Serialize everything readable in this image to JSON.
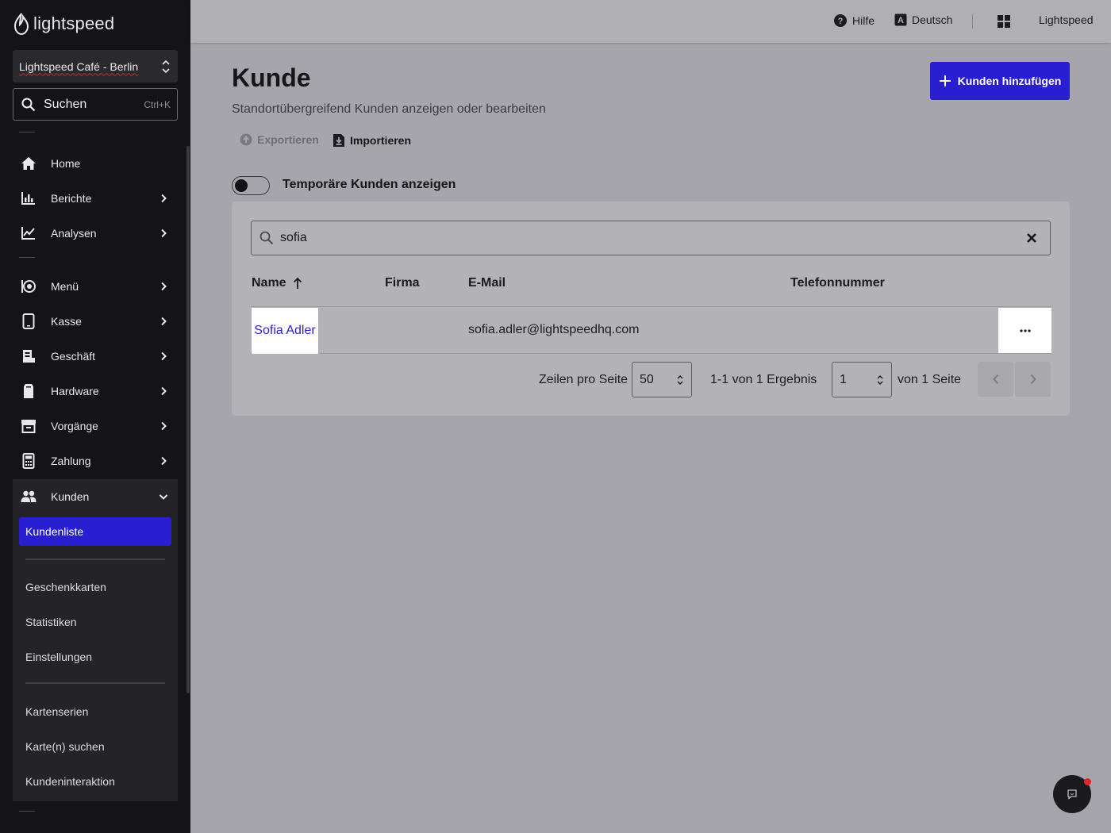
{
  "brand": {
    "name": "lightspeed",
    "accent": "#2a1fd0"
  },
  "sidebar": {
    "location": "Lightspeed Café - Berlin",
    "search": {
      "label": "Suchen",
      "shortcut": "Ctrl+K"
    },
    "items": [
      {
        "label": "Home",
        "icon": "home-icon"
      },
      {
        "label": "Berichte",
        "icon": "bar-chart-icon"
      },
      {
        "label": "Analysen",
        "icon": "line-chart-icon"
      },
      {
        "label": "Menü",
        "icon": "dish-icon"
      },
      {
        "label": "Kasse",
        "icon": "tablet-icon"
      },
      {
        "label": "Geschäft",
        "icon": "store-icon"
      },
      {
        "label": "Hardware",
        "icon": "device-icon"
      },
      {
        "label": "Vorgänge",
        "icon": "archive-icon"
      },
      {
        "label": "Zahlung",
        "icon": "calculator-icon"
      },
      {
        "label": "Kunden",
        "icon": "users-icon"
      }
    ],
    "submenu": {
      "active": "Kundenliste",
      "items": [
        "Geschenkkarten",
        "Statistiken",
        "Einstellungen",
        "Kartenserien",
        "Karte(n) suchen",
        "Kundeninteraktion"
      ]
    }
  },
  "topbar": {
    "help": "Hilfe",
    "language": "Deutsch",
    "account": "Lightspeed"
  },
  "main": {
    "title": "Kunde",
    "subtitle": "Standortübergreifend Kunden anzeigen oder bearbeiten",
    "add_button": "Kunden hinzufügen",
    "export_label": "Exportieren",
    "import_label": "Importieren",
    "toggle_label": "Temporäre Kunden anzeigen",
    "toggle_on": false
  },
  "table": {
    "search_value": "sofia",
    "columns": [
      "Name",
      "Firma",
      "E-Mail",
      "Telefonnummer"
    ],
    "sort": {
      "column": "Name",
      "direction": "ascending"
    },
    "rows": [
      {
        "name": "Sofia Adler",
        "company": "",
        "email": "sofia.adler@lightspeedhq.com",
        "phone": ""
      }
    ]
  },
  "pagination": {
    "rows_label": "Zeilen pro Seite",
    "rows_per_page": "50",
    "summary": "1-1 von 1 Ergebnis",
    "page": "1",
    "of_pages": "von 1 Seite"
  }
}
